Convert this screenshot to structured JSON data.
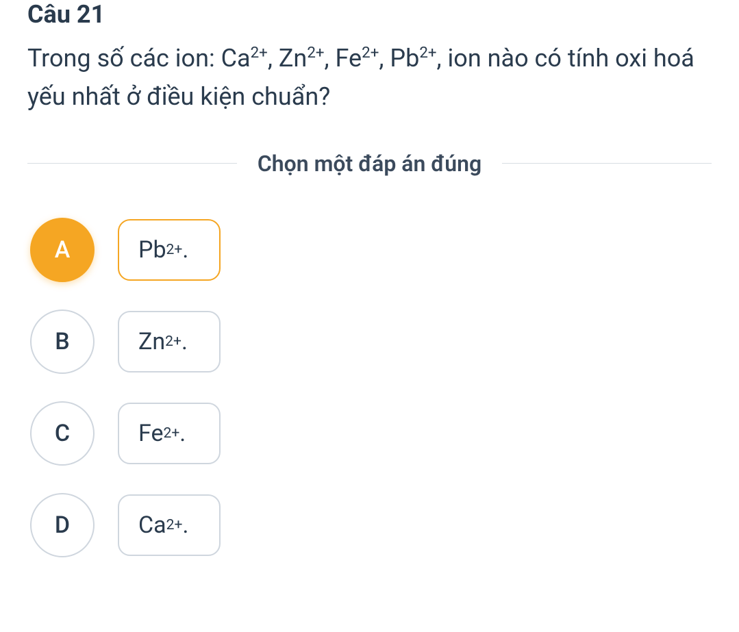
{
  "question": {
    "number": "Câu 21",
    "text_html": "Trong số các ion: Ca<sup>2+</sup>, Zn<sup>2+</sup>, Fe<sup>2+</sup>, Pb<sup>2+</sup>, ion nào có tính oxi hoá yếu nhất ở điều kiện chuẩn?"
  },
  "instruction": "Chọn một đáp án đúng",
  "options": [
    {
      "letter": "A",
      "label_html": "Pb<sup>2+</sup>.",
      "selected": true
    },
    {
      "letter": "B",
      "label_html": "Zn<sup>2+</sup>.",
      "selected": false
    },
    {
      "letter": "C",
      "label_html": "Fe<sup>2+</sup>.",
      "selected": false
    },
    {
      "letter": "D",
      "label_html": "Ca<sup>2+</sup>.",
      "selected": false
    }
  ]
}
